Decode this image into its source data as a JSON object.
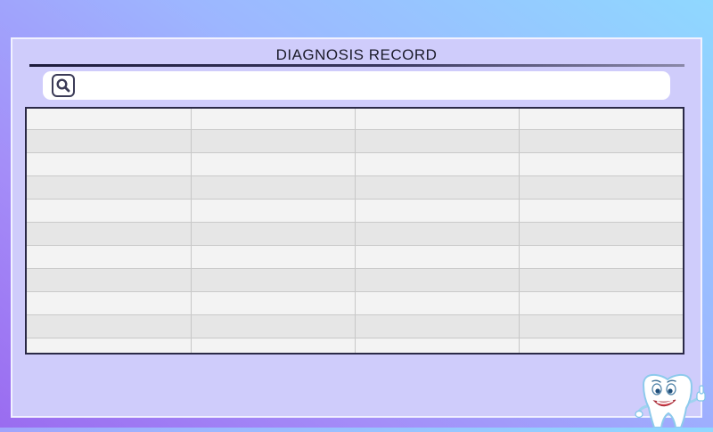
{
  "header": {
    "title": "DIAGNOSIS RECORD"
  },
  "search": {
    "placeholder": "",
    "value": ""
  },
  "table": {
    "columns": 4,
    "rows": [
      [
        "",
        "",
        "",
        ""
      ],
      [
        "",
        "",
        "",
        ""
      ],
      [
        "",
        "",
        "",
        ""
      ],
      [
        "",
        "",
        "",
        ""
      ],
      [
        "",
        "",
        "",
        ""
      ],
      [
        "",
        "",
        "",
        ""
      ],
      [
        "",
        "",
        "",
        ""
      ],
      [
        "",
        "",
        "",
        ""
      ],
      [
        "",
        "",
        "",
        ""
      ],
      [
        "",
        "",
        "",
        ""
      ],
      [
        "",
        "",
        "",
        ""
      ]
    ]
  },
  "icons": {
    "search": "search-icon",
    "mascot": "tooth-mascot-icon"
  },
  "colors": {
    "panel_bg": "#cfccfb",
    "border_dark": "#2a2946",
    "row_light": "#f3f3f3",
    "row_dark": "#e6e6e6"
  }
}
